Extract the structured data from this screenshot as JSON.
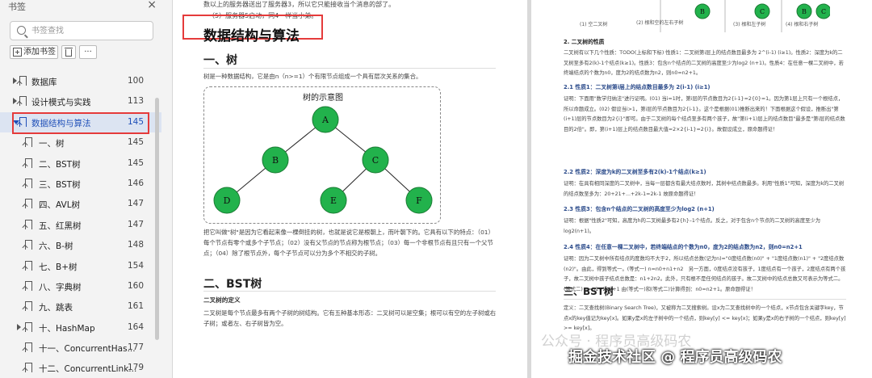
{
  "sidebar": {
    "title": "书签",
    "close_glyph": "×",
    "search_placeholder": "书签查找",
    "add_label": "添加书签",
    "more_label": "···",
    "items": [
      {
        "label": "数据库",
        "page": "100",
        "level": 0,
        "expandable": true
      },
      {
        "label": "设计模式与实践",
        "page": "113",
        "level": 0,
        "expandable": true
      },
      {
        "label": "数据结构与算法",
        "page": "145",
        "level": 0,
        "expandable": true,
        "active": true
      },
      {
        "label": "一、树",
        "page": "145",
        "level": 1
      },
      {
        "label": "二、BST树",
        "page": "145",
        "level": 1
      },
      {
        "label": "三、BST树",
        "page": "146",
        "level": 1
      },
      {
        "label": "四、AVL树",
        "page": "147",
        "level": 1
      },
      {
        "label": "五、红黑树",
        "page": "147",
        "level": 1
      },
      {
        "label": "六、B-树",
        "page": "148",
        "level": 1
      },
      {
        "label": "七、B+树",
        "page": "154",
        "level": 1
      },
      {
        "label": "八、字典树",
        "page": "160",
        "level": 1
      },
      {
        "label": "九、跳表",
        "page": "161",
        "level": 1
      },
      {
        "label": "十、HashMap",
        "page": "164",
        "level": 1,
        "expandable": true
      },
      {
        "label": "十一、ConcurrentHas...",
        "page": "177",
        "level": 1
      },
      {
        "label": "十二、ConcurrentLink...",
        "page": "179",
        "level": 1
      }
    ]
  },
  "left_page": {
    "top_line": "数以上的服务器送出了服务器3，所以它只能接收当个消息的部了。",
    "top_line2": "（5）服务器5启动，同4一样当小弟。",
    "title": "数据结构与算法",
    "section1": "一、树",
    "section1_intro": "树是一种数据结构，它是由n（n>=1）个有限节点组成一个具有层次关系的集合。",
    "tree_caption": "树的示意图",
    "tree_nodes": [
      "A",
      "B",
      "C",
      "D",
      "E",
      "F"
    ],
    "tree_desc": "把它叫做\"树\"是因为它看起来像一棵倒挂的树，也就是说它是根朝上，而叶朝下的。它具有以下的特点：（01）每个节点有零个或多个子节点；（02）没有父节点的节点称为根节点；（03）每一个非根节点有且只有一个父节点；（04）除了根节点外，每个子节点可以分为多个不相交的子树。",
    "section2": "二、BST树",
    "sub1": "二叉树的定义",
    "sub1_text": "二叉树是每个节点最多有两个子树的树结构。它有五种基本形态：二叉树可以是空集；根可以有空的左子树或右子树；或者左、右子树皆为空。"
  },
  "right_page": {
    "fig_labels": [
      "(1) 空二叉树",
      "(2) 根和空的左右子树",
      "(3) 根和左子树",
      "(4) 根和右子树"
    ],
    "fig_nodes": [
      "B",
      "C",
      "B",
      "C"
    ],
    "heading_props": "2. 二叉树的性质",
    "props_text": "二叉树有以下几个性质：TODO(上标和下标) 性质1：二叉树第i层上的结点数目最多为 2^(i-1) (i≥1)。性质2：深度为k的二叉树至多有2(k)-1个结点(k≥1)。性质3：包含n个结点的二叉树的高度至少为log2 (n+1)。性质4：在任意一棵二叉树中，若终端结点的个数为n0，度为2的结点数为n2，则n0=n2+1。",
    "p21": "2.1 性质1：二叉树第i层上的结点数目最多为 2(i-1) (i≥1)",
    "p21_text": "证明：下面用\"数学归纳法\"进行证明。(01) 当i=1时，第i层的节点数目为2{i-1}=2{0}=1。因为第1层上只有一个根结点，所以命题成立。(02) 假设当i>1，第i层的节点数目为2{i-1}。这个是根据(01)推断出来的！下面根据这个假设，推断出\"第(i+1)层的节点数目为2{i}\"即可。由于二叉树的每个结点至多有两个孩子，故\"第(i+1)层上的结点数目\"最多是\"第i层的结点数目的2倍\"。即，第(i+1)层上的结点数目最大值=2×2{i-1}=2{i}。故假设成立，原命题得证！",
    "p22": "2.2 性质2：深度为k的二叉树至多有2(k)-1个结点(k≥1)",
    "p22_text": "证明：在具有相同深度的二叉树中，当每一层都含有最大结点数时，其树中结点数最多。利用\"性质1\"可知，深度为k的二叉树的结点数至多为：20+21+...+2k-1=2k-1 故原命题得证！",
    "p23": "2.3 性质3：包含n个结点的二叉树的高度至少为log2 (n+1)",
    "p23_text": "证明：根据\"性质2\"可知，高度为h的二叉树最多有2{h}–1个结点。反之，对于包含n个节点的二叉树的高度至少为log2(n+1)。",
    "p24": "2.4 性质4：在任意一棵二叉树中，若终端结点的个数为n0，度为2的结点数为n2，则n0=n2+1",
    "p24_text": "证明：因为二叉树中所有结点的度数均不大于2，所以结点总数(记为n)=\"0度结点数(n0)\" + \"1度结点数(n1)\" + \"2度结点数(n2)\"。由此，得到等式一。(等式一) n=n0+n1+n2　另一方面，0度结点没有孩子，1度结点有一个孩子，2度结点有两个孩子，故二叉树中孩子结点总数是：n1+2n2。此外，只有根不是任何结点的孩子。故二叉树中的结点总数又可表示为等式二。(等式二) n=n1+2n2+1 由(等式一)和(等式二)计算得到：n0=n2+1。原命题得证！",
    "section3": "三、BST树",
    "def_text": "定义：二叉查找树(Binary Search Tree)，又被称为二叉搜索树。设x为二叉查找树中的一个结点，x节点包含关键字key，节点x的key值记为key[x]。如果y是x的左子树中的一个结点，则key[y] <= key[x]；如果y是x的右子树的一个结点，则key[y] >= key[x]。"
  },
  "watermark": {
    "faint": "公众号 · 程序员高级码农",
    "main": "掘金技术社区 @ 程序员高级码农"
  },
  "colors": {
    "node_fill": "#22b24c",
    "node_stroke": "#1a7a33",
    "highlight_red": "#e53b3b",
    "active_blue": "#1f4fb8"
  }
}
